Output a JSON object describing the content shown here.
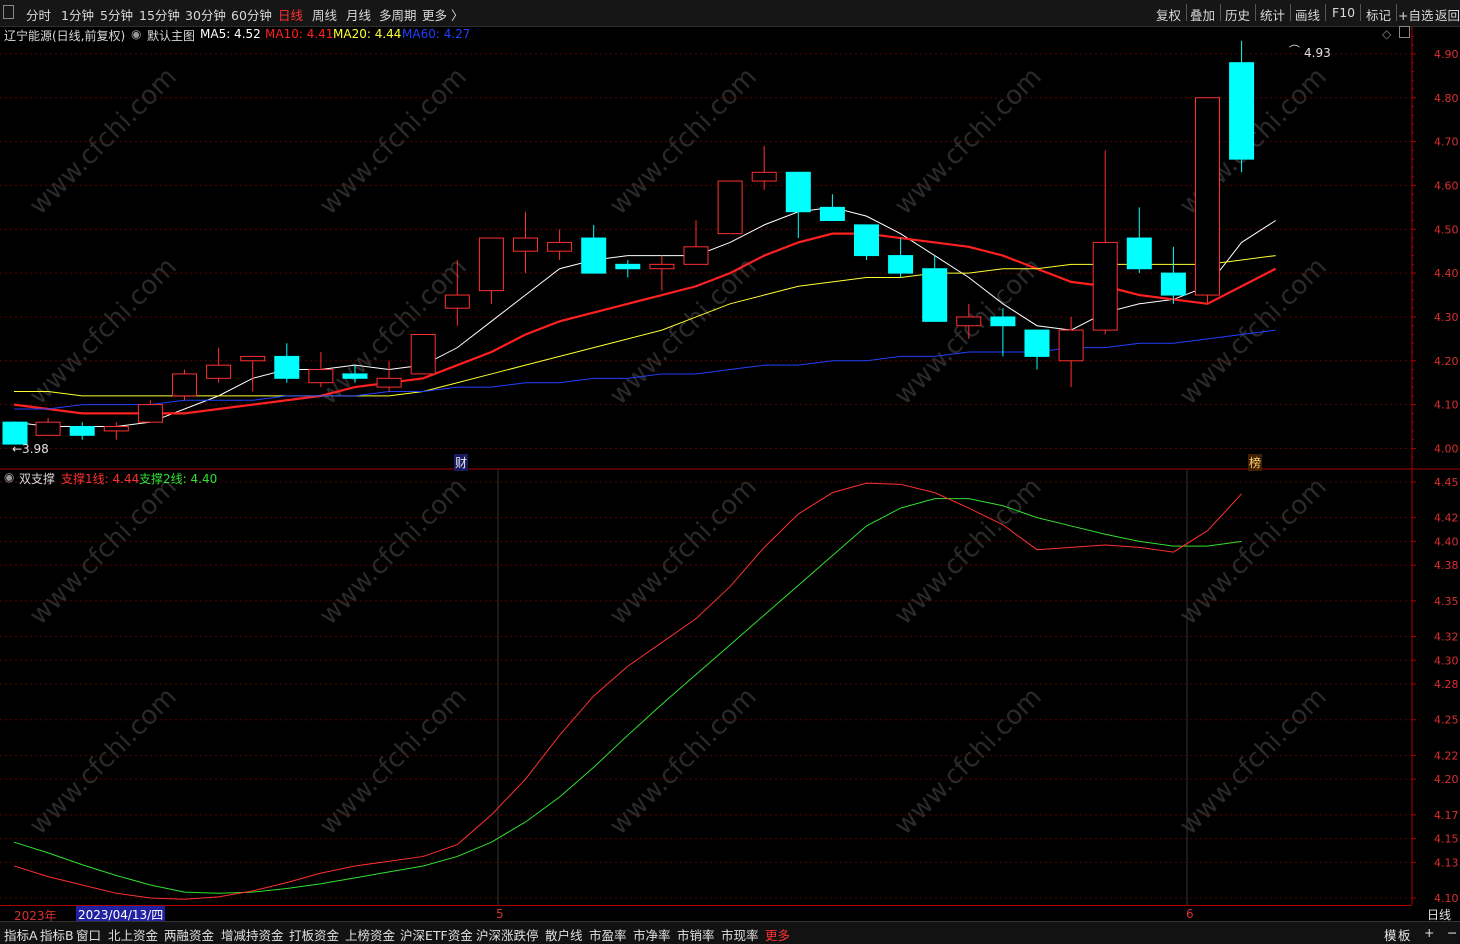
{
  "toolbar": {
    "timeframes": [
      "分时",
      "1分钟",
      "5分钟",
      "15分钟",
      "30分钟",
      "60分钟",
      "日线",
      "周线",
      "月线",
      "多周期",
      "更多 〉"
    ],
    "active_timeframe": "日线",
    "right_buttons": [
      "复权",
      "叠加",
      "历史",
      "统计",
      "画线",
      "F10",
      "标记",
      "+自选",
      "返回"
    ]
  },
  "main_panel": {
    "stock": "辽宁能源(日线,前复权)",
    "theme_label": "默认主图",
    "ma": [
      {
        "label": "MA5: 4.52",
        "color": "#ffffff"
      },
      {
        "label": "MA10: 4.41",
        "color": "#ff2020"
      },
      {
        "label": "MA20: 4.44",
        "color": "#ffff30"
      },
      {
        "label": "MA60: 4.27",
        "color": "#2040ff"
      }
    ],
    "high_label": "4.93",
    "low_label": "←3.98",
    "event_markers": [
      "财",
      "榜"
    ],
    "y_ticks": [
      "4.90",
      "4.80",
      "4.70",
      "4.60",
      "4.50",
      "4.40",
      "4.30",
      "4.20",
      "4.10",
      "4.00"
    ]
  },
  "sub_panel": {
    "name": "双支撑",
    "lines": [
      {
        "label": "支撑1线: 4.44",
        "color": "#ff3030"
      },
      {
        "label": "支撑2线: 4.40",
        "color": "#30e030"
      }
    ],
    "y_ticks": [
      "4.45",
      "4.42",
      "4.40",
      "4.38",
      "4.35",
      "4.32",
      "4.30",
      "4.28",
      "4.25",
      "4.22",
      "4.20",
      "4.17",
      "4.15",
      "4.13",
      "4.10"
    ]
  },
  "date_axis": {
    "year": "2023年",
    "cursor_date": "2023/04/13/四",
    "month_marks": [
      "5",
      "6"
    ],
    "period": "日线"
  },
  "bottom_tabs": [
    "指标A",
    "指标B",
    "窗口",
    "北上资金",
    "两融资金",
    "增减持资金",
    "打板资金",
    "上榜资金",
    "沪深ETF资金",
    "沪深涨跌停",
    "散户线",
    "市盈率",
    "市净率",
    "市销率",
    "市现率",
    "更多"
  ],
  "bottom_right": [
    "模",
    "板",
    "+",
    "−"
  ],
  "watermark": "www.cfchi.com",
  "chart_data": {
    "type": "candlestick",
    "dates_note": "",
    "candles": [
      [
        4.06,
        4.01,
        4.06,
        4.01
      ],
      [
        4.03,
        4.06,
        4.07,
        4.03
      ],
      [
        4.05,
        4.03,
        4.06,
        4.02
      ],
      [
        4.04,
        4.05,
        4.06,
        4.02
      ],
      [
        4.06,
        4.1,
        4.11,
        4.06
      ],
      [
        4.12,
        4.17,
        4.18,
        4.11
      ],
      [
        4.16,
        4.19,
        4.23,
        4.15
      ],
      [
        4.2,
        4.21,
        4.21,
        4.13
      ],
      [
        4.21,
        4.16,
        4.24,
        4.15
      ],
      [
        4.15,
        4.18,
        4.22,
        4.14
      ],
      [
        4.17,
        4.16,
        4.19,
        4.15
      ],
      [
        4.14,
        4.16,
        4.2,
        4.13
      ],
      [
        4.17,
        4.26,
        4.26,
        4.17
      ],
      [
        4.32,
        4.35,
        4.43,
        4.28
      ],
      [
        4.36,
        4.48,
        4.48,
        4.33
      ],
      [
        4.45,
        4.48,
        4.54,
        4.4
      ],
      [
        4.45,
        4.47,
        4.5,
        4.43
      ],
      [
        4.48,
        4.4,
        4.51,
        4.4
      ],
      [
        4.42,
        4.41,
        4.43,
        4.39
      ],
      [
        4.41,
        4.42,
        4.44,
        4.36
      ],
      [
        4.42,
        4.46,
        4.52,
        4.42
      ],
      [
        4.49,
        4.61,
        4.61,
        4.49
      ],
      [
        4.61,
        4.63,
        4.69,
        4.59
      ],
      [
        4.63,
        4.54,
        4.63,
        4.48
      ],
      [
        4.55,
        4.52,
        4.58,
        4.52
      ],
      [
        4.51,
        4.44,
        4.51,
        4.43
      ],
      [
        4.44,
        4.4,
        4.48,
        4.39
      ],
      [
        4.41,
        4.29,
        4.44,
        4.29
      ],
      [
        4.28,
        4.3,
        4.33,
        4.25
      ],
      [
        4.3,
        4.28,
        4.32,
        4.21
      ],
      [
        4.27,
        4.21,
        4.27,
        4.18
      ],
      [
        4.2,
        4.27,
        4.3,
        4.14
      ],
      [
        4.27,
        4.47,
        4.68,
        4.26
      ],
      [
        4.48,
        4.41,
        4.55,
        4.4
      ],
      [
        4.4,
        4.35,
        4.46,
        4.33
      ],
      [
        4.35,
        4.8,
        4.8,
        4.33
      ],
      [
        4.88,
        4.66,
        4.93,
        4.63
      ]
    ],
    "ma_series": {
      "MA5": [
        4.06,
        4.05,
        4.05,
        4.05,
        4.06,
        4.09,
        4.12,
        4.16,
        4.18,
        4.18,
        4.19,
        4.18,
        4.19,
        4.23,
        4.29,
        4.35,
        4.41,
        4.43,
        4.44,
        4.44,
        4.44,
        4.47,
        4.51,
        4.54,
        4.55,
        4.53,
        4.49,
        4.44,
        4.39,
        4.33,
        4.28,
        4.27,
        4.31,
        4.33,
        4.34,
        4.37,
        4.47,
        4.52
      ],
      "MA10": [
        4.1,
        4.09,
        4.08,
        4.08,
        4.08,
        4.08,
        4.09,
        4.1,
        4.11,
        4.12,
        4.14,
        4.15,
        4.16,
        4.19,
        4.22,
        4.26,
        4.29,
        4.31,
        4.33,
        4.35,
        4.37,
        4.4,
        4.44,
        4.47,
        4.49,
        4.49,
        4.48,
        4.47,
        4.46,
        4.44,
        4.41,
        4.38,
        4.37,
        4.35,
        4.34,
        4.33,
        4.37,
        4.41
      ],
      "MA20": [
        4.13,
        4.13,
        4.12,
        4.12,
        4.12,
        4.12,
        4.12,
        4.12,
        4.12,
        4.12,
        4.12,
        4.12,
        4.13,
        4.15,
        4.17,
        4.19,
        4.21,
        4.23,
        4.25,
        4.27,
        4.3,
        4.33,
        4.35,
        4.37,
        4.38,
        4.39,
        4.39,
        4.4,
        4.4,
        4.41,
        4.41,
        4.42,
        4.42,
        4.42,
        4.42,
        4.42,
        4.43,
        4.44
      ],
      "MA60": [
        4.09,
        4.09,
        4.1,
        4.1,
        4.1,
        4.11,
        4.11,
        4.11,
        4.12,
        4.12,
        4.12,
        4.13,
        4.13,
        4.14,
        4.14,
        4.15,
        4.15,
        4.16,
        4.16,
        4.17,
        4.17,
        4.18,
        4.19,
        4.19,
        4.2,
        4.2,
        4.21,
        4.21,
        4.22,
        4.22,
        4.22,
        4.23,
        4.23,
        4.24,
        4.24,
        4.25,
        4.26,
        4.27
      ]
    },
    "support1": [
      4.127,
      4.118,
      4.111,
      4.104,
      4.1,
      4.099,
      4.101,
      4.106,
      4.113,
      4.121,
      4.127,
      4.131,
      4.135,
      4.145,
      4.17,
      4.2,
      4.237,
      4.27,
      4.295,
      4.315,
      4.335,
      4.362,
      4.395,
      4.423,
      4.441,
      4.449,
      4.448,
      4.441,
      4.428,
      4.414,
      4.393,
      4.395,
      4.397,
      4.395,
      4.391,
      4.409,
      4.44
    ],
    "support2": [
      4.147,
      4.138,
      4.128,
      4.119,
      4.111,
      4.105,
      4.104,
      4.105,
      4.108,
      4.112,
      4.117,
      4.122,
      4.127,
      4.135,
      4.147,
      4.164,
      4.185,
      4.21,
      4.237,
      4.263,
      4.288,
      4.313,
      4.338,
      4.363,
      4.388,
      4.413,
      4.428,
      4.436,
      4.436,
      4.43,
      4.42,
      4.413,
      4.406,
      4.4,
      4.396,
      4.396,
      4.4
    ],
    "y_range_main": [
      3.96,
      4.95
    ],
    "y_range_sub": [
      4.095,
      4.455
    ]
  },
  "colors": {
    "up_candle": "#ff3030",
    "down_candle": "#00ffff",
    "axis": "#aa0000",
    "grid": "#5a0000"
  }
}
